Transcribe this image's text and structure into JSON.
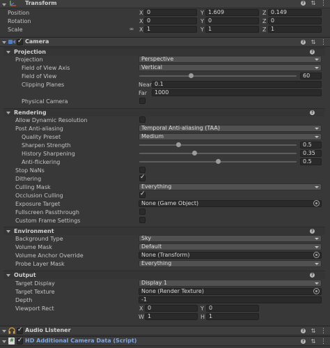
{
  "transform": {
    "title": "Transform",
    "position_label": "Position",
    "rotation_label": "Rotation",
    "scale_label": "Scale",
    "x": "X",
    "y": "Y",
    "z": "Z",
    "position": {
      "x": "0",
      "y": "1.609",
      "z": "0.149"
    },
    "rotation": {
      "x": "0",
      "y": "0",
      "z": "0"
    },
    "scale": {
      "x": "1",
      "y": "1",
      "z": "1"
    }
  },
  "camera": {
    "title": "Camera",
    "projection": {
      "section": "Projection",
      "projection_label": "Projection",
      "projection_value": "Perspective",
      "fov_axis_label": "Field of View Axis",
      "fov_axis_value": "Vertical",
      "fov_label": "Field of View",
      "fov_value": "60",
      "fov_fraction": 0.33,
      "clipping_label": "Clipping Planes",
      "near_label": "Near",
      "near_value": "0.1",
      "far_label": "Far",
      "far_value": "1000",
      "physical_label": "Physical Camera"
    },
    "rendering": {
      "section": "Rendering",
      "dyn_res_label": "Allow Dynamic Resolution",
      "post_aa_label": "Post Anti-aliasing",
      "post_aa_value": "Temporal Anti-aliasing (TAA)",
      "quality_label": "Quality Preset",
      "quality_value": "Medium",
      "sharpen_label": "Sharpen Strength",
      "sharpen_value": "0.5",
      "sharpen_fraction": 0.25,
      "history_label": "History Sharpening",
      "history_value": "0.35",
      "history_fraction": 0.35,
      "flicker_label": "Anti-flickering",
      "flicker_value": "0.5",
      "flicker_fraction": 0.5,
      "stop_nans_label": "Stop NaNs",
      "dithering_label": "Dithering",
      "culling_label": "Culling Mask",
      "culling_value": "Everything",
      "occlusion_label": "Occlusion Culling",
      "exposure_label": "Exposure Target",
      "exposure_value": "None (Game Object)",
      "fullscreen_label": "Fullscreen Passthrough",
      "custom_frame_label": "Custom Frame Settings"
    },
    "environment": {
      "section": "Environment",
      "bg_label": "Background Type",
      "bg_value": "Sky",
      "volume_mask_label": "Volume Mask",
      "volume_mask_value": "Default",
      "anchor_label": "Volume Anchor Override",
      "anchor_value": "None (Transform)",
      "probe_label": "Probe Layer Mask",
      "probe_value": "Everything"
    },
    "output": {
      "section": "Output",
      "target_display_label": "Target Display",
      "target_display_value": "Display 1",
      "target_texture_label": "Target Texture",
      "target_texture_value": "None (Render Texture)",
      "depth_label": "Depth",
      "depth_value": "-1",
      "viewport_label": "Viewport Rect",
      "x_label": "X",
      "x_value": "0",
      "y_label": "Y",
      "y_value": "0",
      "w_label": "W",
      "w_value": "1",
      "h_label": "H",
      "h_value": "1"
    }
  },
  "audio_listener": {
    "title": "Audio Listener"
  },
  "hd_camera": {
    "title": "HD Additional Camera Data (Script)"
  },
  "colors": {
    "accent_blue": "#4a7fc9",
    "check": "#e0e0e0",
    "script_title": "#7fa8e0"
  }
}
